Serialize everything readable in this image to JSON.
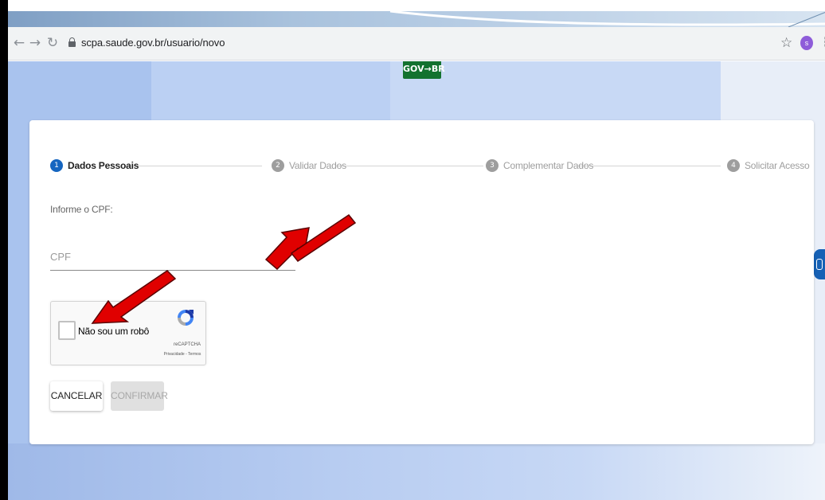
{
  "browser": {
    "url": "scpa.saude.gov.br/usuario/novo",
    "profile_initial": "s",
    "icons": {
      "back": "arrow-left-icon",
      "forward": "arrow-right-icon",
      "reload": "reload-icon",
      "lock": "lock-icon",
      "bookmark": "star-icon",
      "menu": "kebab-menu-icon"
    }
  },
  "header": {
    "logo_text": "GOV→BR",
    "logo_color": "#13722f"
  },
  "stepper": {
    "steps": [
      {
        "number": "1",
        "label": "Dados Pessoais",
        "active": true
      },
      {
        "number": "2",
        "label": "Validar Dados",
        "active": false
      },
      {
        "number": "3",
        "label": "Complementar Dados",
        "active": false
      },
      {
        "number": "4",
        "label": "Solicitar Acesso",
        "active": false
      }
    ],
    "active_color": "#1565c0"
  },
  "form": {
    "prompt": "Informe o CPF:",
    "cpf_placeholder": "CPF",
    "cpf_value": ""
  },
  "recaptcha": {
    "label": "Não sou um robô",
    "brand": "reCAPTCHA",
    "links": "Privacidade - Termos",
    "checked": false
  },
  "actions": {
    "cancel_label": "CANCELAR",
    "confirm_label": "CONFIRMAR",
    "confirm_enabled": false
  },
  "annotations": {
    "arrow_color": "#e00000"
  }
}
